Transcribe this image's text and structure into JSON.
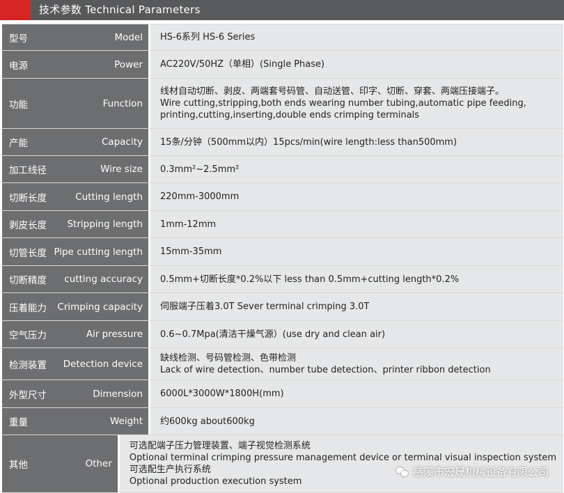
{
  "header": {
    "title": "技术参数  Technical Parameters",
    "accent_color": "#d62323",
    "bar_color": "#58595b"
  },
  "rows": [
    {
      "zh": "型号",
      "en": "Model",
      "value": [
        "HS-6系列 HS-6 Series"
      ]
    },
    {
      "zh": "电源",
      "en": "Power",
      "value": [
        "AC220V/50HZ（单相）(Single Phase)"
      ]
    },
    {
      "zh": "功能",
      "en": "Function",
      "value": [
        "线材自动切断、剥皮、两端套号码管、自动送管、印字、切断、穿套、两端压接端子。",
        "Wire cutting,stripping,both ends wearing number tubing,automatic pipe feeding,",
        "printing,cutting,inserting,double ends crimping terminals"
      ]
    },
    {
      "zh": "产能",
      "en": "Capacity",
      "value": [
        "15条/分钟（500mm以内）15pcs/min(wire length:less than500mm)"
      ]
    },
    {
      "zh": "加工线径",
      "en": "Wire size",
      "value": [
        "0.3mm²~2.5mm²"
      ]
    },
    {
      "zh": "切断长度",
      "en": "Cutting length",
      "value": [
        "220mm-3000mm"
      ]
    },
    {
      "zh": "剥皮长度",
      "en": "Stripping length",
      "value": [
        "1mm-12mm"
      ]
    },
    {
      "zh": "切管长度",
      "en": "Pipe cutting length",
      "value": [
        "15mm-35mm"
      ]
    },
    {
      "zh": "切断精度",
      "en": "cutting accuracy",
      "value": [
        "0.5mm+切断长度*0.2%以下 less than 0.5mm+cutting length*0.2%"
      ]
    },
    {
      "zh": "压着能力",
      "en": "Crimping capacity",
      "value": [
        "伺服端子压着3.0T  Sever terminal crimping 3.0T"
      ]
    },
    {
      "zh": "空气压力",
      "en": "Air pressure",
      "value": [
        "0.6~0.7Mpa(清洁干燥气源）(use dry and clean air)"
      ]
    },
    {
      "zh": "检测装置",
      "en": "Detection device",
      "value": [
        "缺线检测、号码管检测、色带检测",
        "Lack of wire detection、number tube detection、printer ribbon detection"
      ]
    },
    {
      "zh": "外型尺寸",
      "en": "Dimension",
      "value": [
        "6000L*3000W*1800H(mm)"
      ]
    },
    {
      "zh": "重量",
      "en": "Weight",
      "value": [
        "约600kg about600kg"
      ]
    },
    {
      "zh": "其他",
      "en": "Other",
      "value": [
        "可选配端子压力管理装置、端子视觉检测系统",
        "Optional terminal crimping pressure management device or terminal visual inspection system",
        "可选配生产执行系统",
        "Optional production execution system"
      ]
    }
  ],
  "watermark": {
    "text": "慈溪市宏晟机械设备有限公司",
    "icon": "wechat-icon"
  }
}
